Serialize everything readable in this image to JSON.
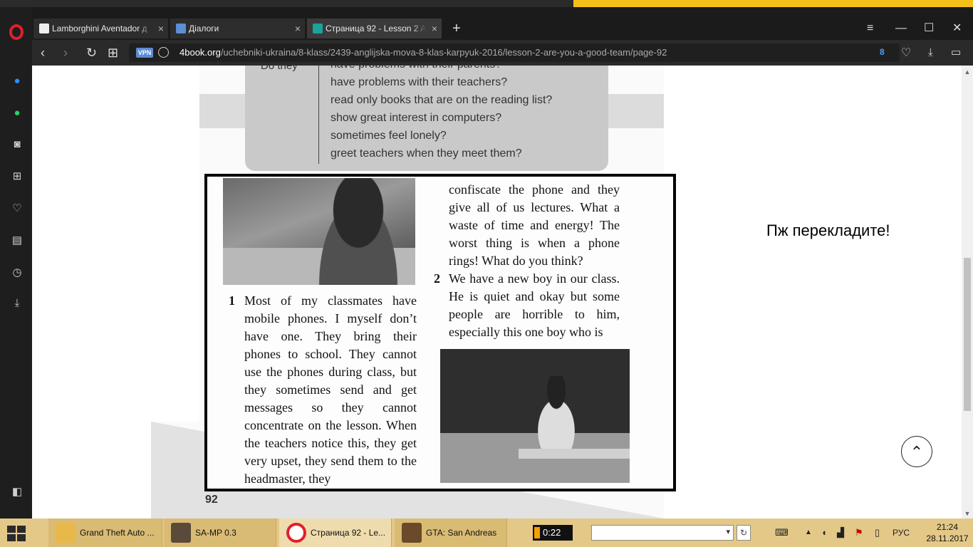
{
  "browser": {
    "tabs": [
      {
        "label": "Lamborghini Aventador д",
        "active": false
      },
      {
        "label": "Діалоги",
        "active": false
      },
      {
        "label": "Страница 92 - Lesson 2 A",
        "active": true
      }
    ],
    "tab_close": "×",
    "new_tab": "+",
    "window_controls": {
      "menu": "≡",
      "minimize": "—",
      "maximize": "☐",
      "close": "✕"
    },
    "nav": {
      "back": "‹",
      "forward": "›",
      "reload": "↻",
      "speed_dial": "⊞"
    },
    "vpn_badge": "VPN",
    "url_host": "4book.org",
    "url_path": "/uchebniki-ukraina/8-klass/2439-anglijska-mova-8-klas-karpyuk-2016/lesson-2-are-you-a-good-team/page-92",
    "adblock_count": "8",
    "icons": {
      "heart": "heart-icon",
      "download": "download-icon",
      "battery": "battery-icon",
      "opera": "opera-logo"
    }
  },
  "sidebar": {
    "icons": [
      "messenger-icon",
      "whatsapp-icon",
      "camera-icon",
      "grid-icon",
      "heart-icon",
      "news-icon",
      "history-icon",
      "download-icon",
      "sidebar-toggle-icon"
    ]
  },
  "book": {
    "question_subject": "Do they",
    "questions": [
      "have problems with their parents?",
      "have problems with their teachers?",
      "read only books that are on the reading list?",
      "show great interest in computers?",
      "sometimes feel lonely?",
      "greet teachers when they meet them?"
    ],
    "item1_number": "1",
    "item1_text": "Most of my classmates have mobile phones. I myself don’t have one. They bring their phones to school. They cannot use the phones during class, but they sometimes send and get messages so they cannot concentrate on the lesson. When the teachers notice this, they get very upset, they send them to the headmaster, they",
    "item1_continued": "confiscate the phone and they give all of us lectures. What a waste of time and energy! The worst thing is when a phone rings! What do you think?",
    "item2_number": "2",
    "item2_text": "We have a new boy in our class. He is quiet and okay but some people are horrible to him, especially this one boy who is",
    "page_number": "92"
  },
  "note": "Пж перекладите!",
  "scroll_top_icon": "chevron-up-icon",
  "taskbar": {
    "tasks": [
      {
        "label": "Grand Theft Auto ...",
        "active": false
      },
      {
        "label": "SA-MP 0.3",
        "active": false
      },
      {
        "label": "Страница 92 - Le...",
        "active": true
      },
      {
        "label": "GTA: San Andreas",
        "active": false
      }
    ],
    "timer": "0:22",
    "language": "РУС",
    "time": "21:24",
    "date": "28.11.2017"
  }
}
